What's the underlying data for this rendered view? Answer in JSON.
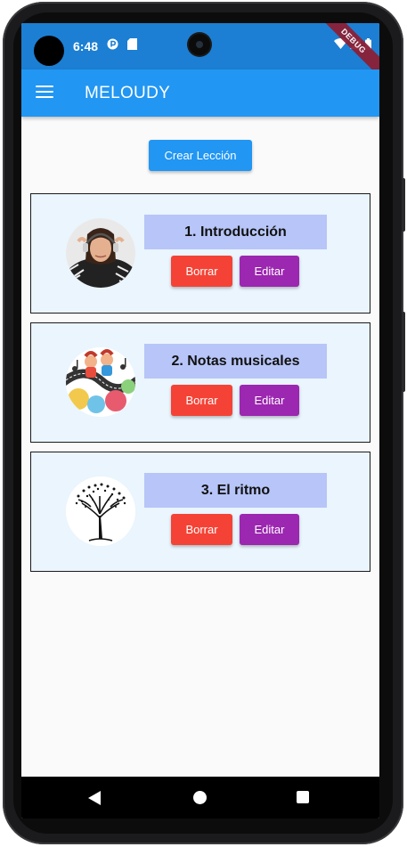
{
  "status_bar": {
    "time": "6:48",
    "icons": [
      "circle-p-icon",
      "sd-card-icon",
      "wifi-icon",
      "signal-icon",
      "battery-icon"
    ],
    "debug_banner": "DEBUG"
  },
  "app_bar": {
    "title": "MELOUDY",
    "menu_icon": "hamburger-menu-icon",
    "color": "#2196f3"
  },
  "create_button": {
    "label": "Crear Lección",
    "color": "#2196f3"
  },
  "lessons": [
    {
      "title": "1. Introducción",
      "delete_label": "Borrar",
      "edit_label": "Editar",
      "image": "girl-with-headphones"
    },
    {
      "title": "2. Notas musicales",
      "delete_label": "Borrar",
      "edit_label": "Editar",
      "image": "kids-with-music-notes"
    },
    {
      "title": "3. El ritmo",
      "delete_label": "Borrar",
      "edit_label": "Editar",
      "image": "tree-of-music-notes"
    }
  ],
  "colors": {
    "delete": "#f44336",
    "edit": "#9c27b0",
    "title_bg": "#b7c5f8",
    "card_bg": "#eaf5fd"
  },
  "nav_bar": {
    "icons": [
      "back-icon",
      "home-icon",
      "recent-apps-icon"
    ]
  }
}
